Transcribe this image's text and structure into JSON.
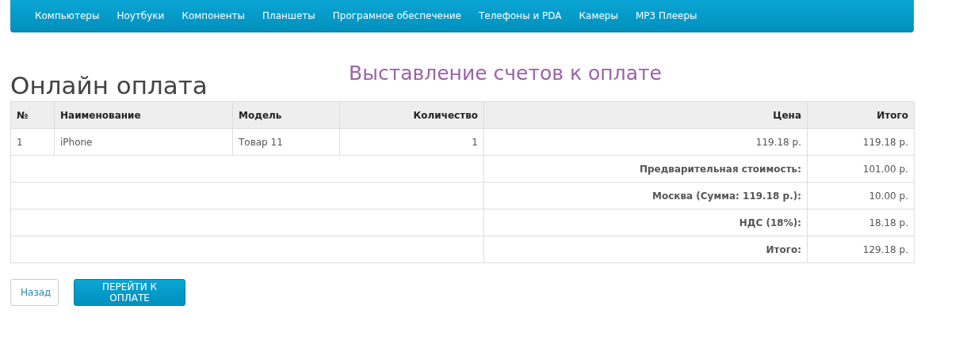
{
  "nav": {
    "items": [
      {
        "label": "Компьютеры"
      },
      {
        "label": "Ноутбуки"
      },
      {
        "label": "Компоненты"
      },
      {
        "label": "Планшеты"
      },
      {
        "label": "Програмное обеспечение"
      },
      {
        "label": "Телефоны и PDA"
      },
      {
        "label": "Камеры"
      },
      {
        "label": "MP3 Плееры"
      }
    ]
  },
  "title": "Онлайн оплата",
  "annotation": "Выставление счетов к оплате",
  "table": {
    "columns": [
      "№",
      "Наименование",
      "Модель",
      "Количество",
      "Цена",
      "Итого"
    ],
    "rows": [
      [
        "1",
        "iPhone",
        "Товар 11",
        "1",
        "119.18 р.",
        "119.18 р."
      ]
    ],
    "totals": [
      {
        "label": "Предварительная стоимость:",
        "value": "101.00 р."
      },
      {
        "label": "Москва (Сумма: 119.18 р.):",
        "value": "10.00 р."
      },
      {
        "label": "НДС (18%):",
        "value": "18.18 р."
      },
      {
        "label": "Итого:",
        "value": "129.18 р."
      }
    ]
  },
  "buttons": {
    "back": "Назад",
    "checkout": "ПЕРЕЙТИ К ОПЛАТЕ"
  }
}
